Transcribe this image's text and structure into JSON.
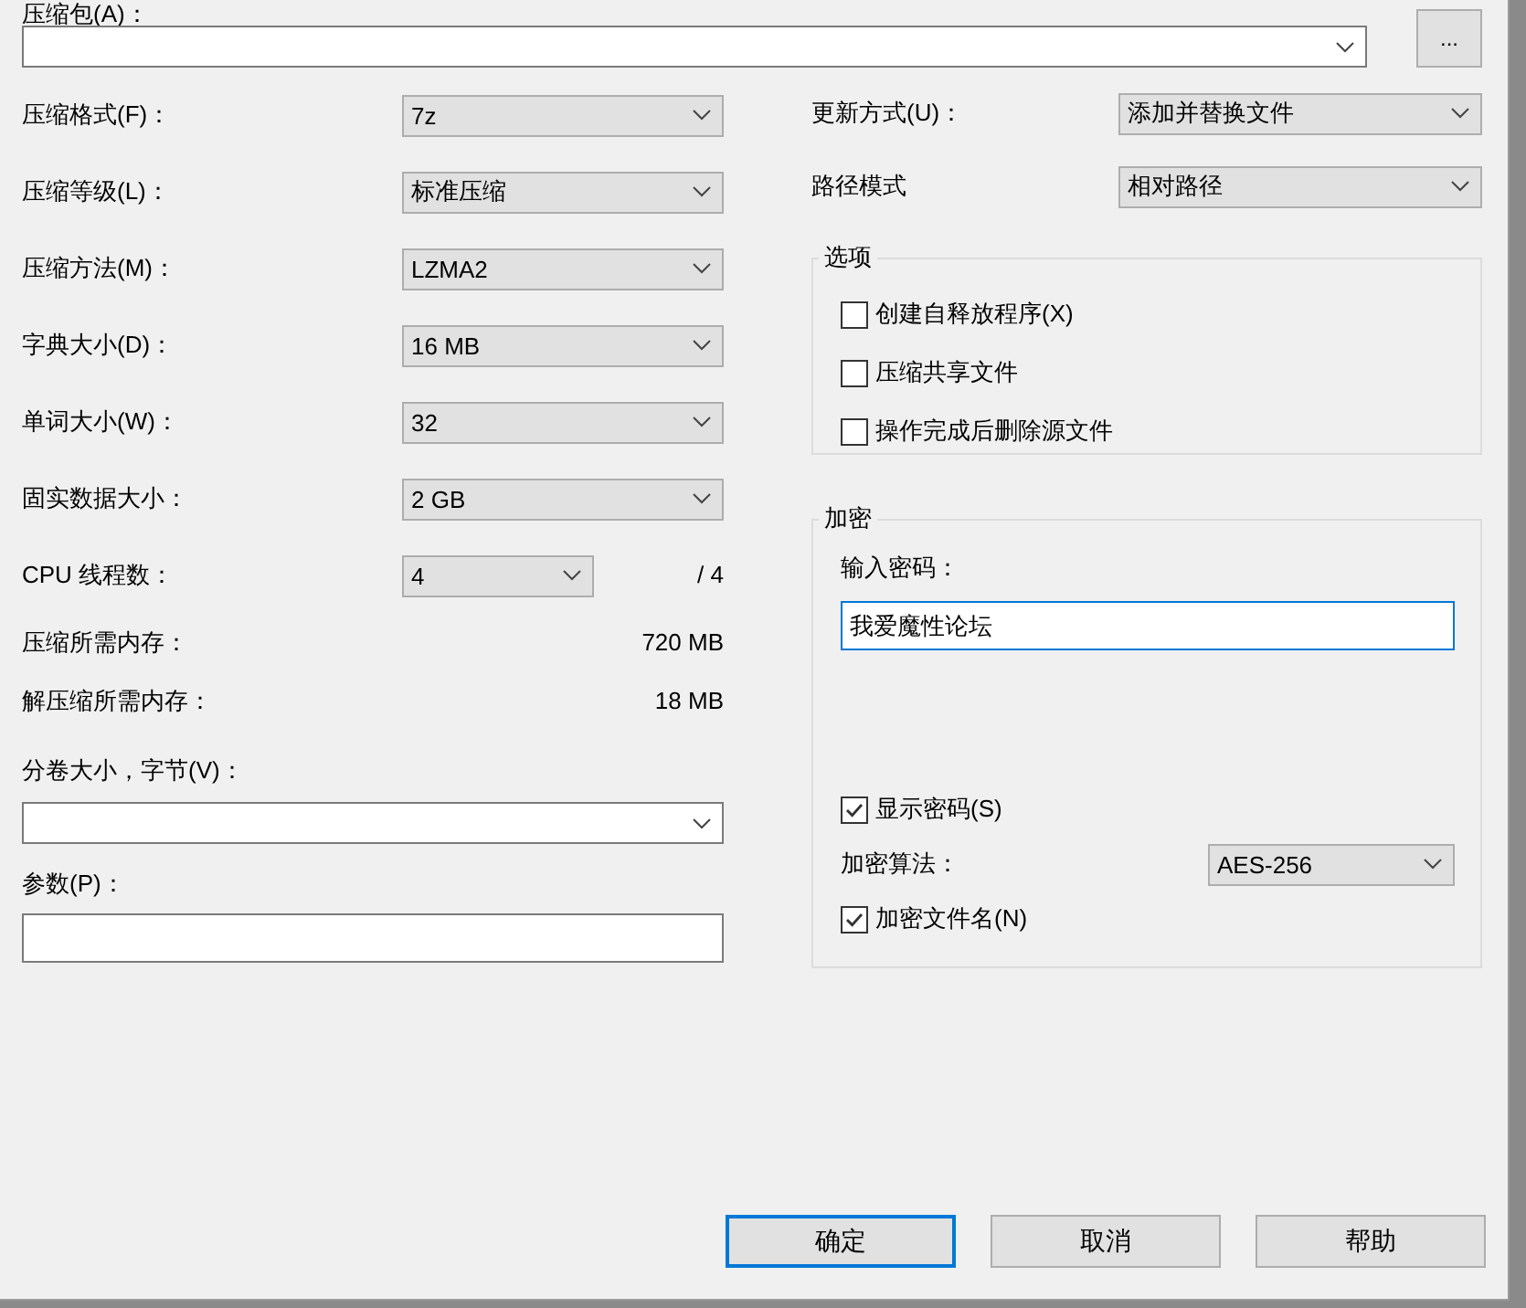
{
  "archive": {
    "label": "压缩包(A)：",
    "browse_button": "..."
  },
  "left_fields": [
    {
      "kind": "select",
      "label": "压缩格式(F)：",
      "value": "7z"
    },
    {
      "kind": "select",
      "label": "压缩等级(L)：",
      "value": "标准压缩"
    },
    {
      "kind": "select",
      "label": "压缩方法(M)：",
      "value": "LZMA2"
    },
    {
      "kind": "select",
      "label": "字典大小(D)：",
      "value": "16 MB"
    },
    {
      "kind": "select",
      "label": "单词大小(W)：",
      "value": "32"
    },
    {
      "kind": "select",
      "label": "固实数据大小：",
      "value": "2 GB"
    },
    {
      "kind": "threads",
      "label": "CPU 线程数：",
      "value": "4",
      "suffix": "/ 4"
    },
    {
      "kind": "readout",
      "label": "压缩所需内存：",
      "value": "720 MB"
    },
    {
      "kind": "readout",
      "label": "解压缩所需内存：",
      "value": "18 MB"
    }
  ],
  "volume": {
    "label": "分卷大小，字节(V)："
  },
  "params": {
    "label": "参数(P)："
  },
  "right_fields": [
    {
      "label": "更新方式(U)：",
      "value": "添加并替换文件"
    },
    {
      "label": "路径模式",
      "value": "相对路径"
    }
  ],
  "options": {
    "title": "选项",
    "items": [
      {
        "label": "创建自释放程序(X)",
        "checked": false
      },
      {
        "label": "压缩共享文件",
        "checked": false
      },
      {
        "label": "操作完成后删除源文件",
        "checked": false
      }
    ]
  },
  "encryption": {
    "title": "加密",
    "password_label": "输入密码：",
    "password": "我爱魔性论坛",
    "show_password": {
      "label": "显示密码(S)",
      "checked": true
    },
    "method_label": "加密算法：",
    "method": "AES-256",
    "encrypt_names": {
      "label": "加密文件名(N)",
      "checked": true
    }
  },
  "buttons": [
    {
      "label": "确定",
      "selected": true
    },
    {
      "label": "取消",
      "selected": false
    },
    {
      "label": "帮助",
      "selected": false
    }
  ]
}
